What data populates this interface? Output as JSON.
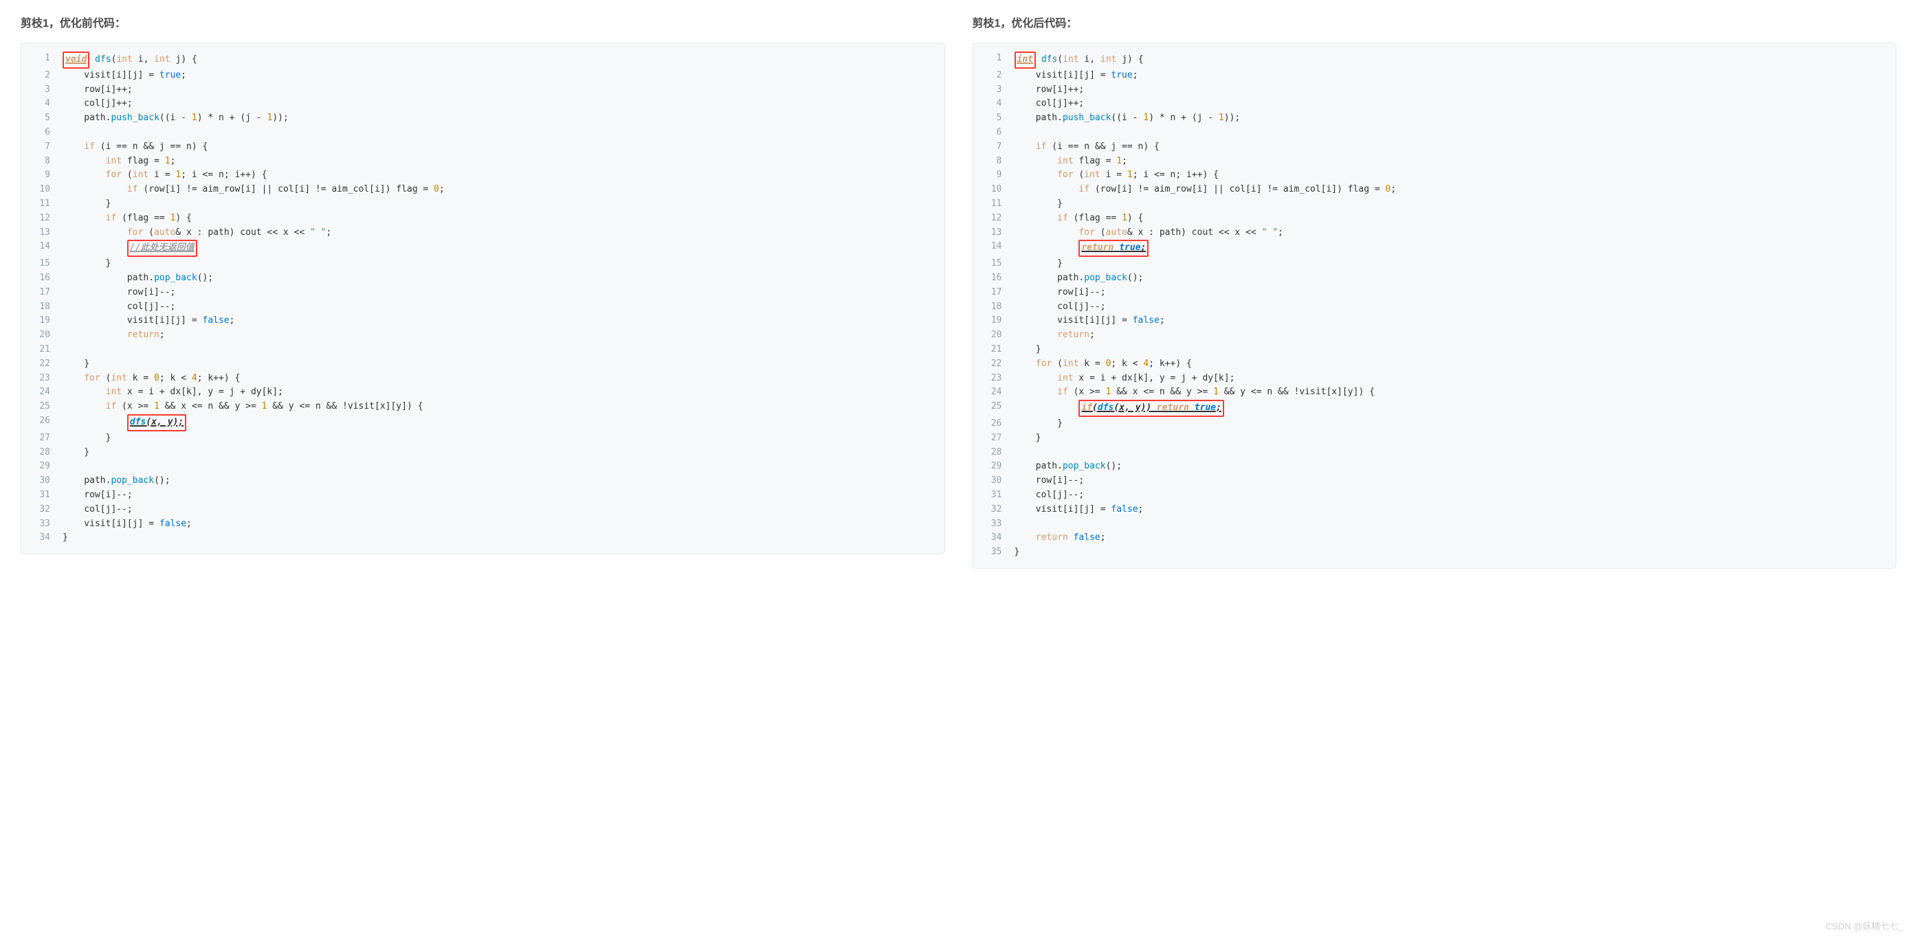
{
  "left": {
    "heading": "剪枝1，优化前代码：",
    "lines": [
      {
        "n": 1,
        "html": "<span class='redbox'><span class='em-under kw'>void</span></span> <span class='fn'>dfs</span>(<span class='kw'>int</span> i, <span class='kw'>int</span> j) {"
      },
      {
        "n": 2,
        "html": "    visit[i][j] = <span class='bool'>true</span>;"
      },
      {
        "n": 3,
        "html": "    row[i]++;"
      },
      {
        "n": 4,
        "html": "    col[j]++;"
      },
      {
        "n": 5,
        "html": "    path.<span class='fn'>push_back</span>((i - <span class='num'>1</span>) * n + (j - <span class='num'>1</span>));"
      },
      {
        "n": 6,
        "html": ""
      },
      {
        "n": 7,
        "html": "    <span class='kw'>if</span> (i == n &amp;&amp; j == n) {"
      },
      {
        "n": 8,
        "html": "        <span class='kw'>int</span> flag = <span class='num'>1</span>;"
      },
      {
        "n": 9,
        "html": "        <span class='kw'>for</span> (<span class='kw'>int</span> i = <span class='num'>1</span>; i &lt;= n; i++) {"
      },
      {
        "n": 10,
        "html": "            <span class='kw'>if</span> (row[i] != aim_row[i] || col[i] != aim_col[i]) flag = <span class='num'>0</span>;"
      },
      {
        "n": 11,
        "html": "        }"
      },
      {
        "n": 12,
        "html": "        <span class='kw'>if</span> (flag == <span class='num'>1</span>) {"
      },
      {
        "n": 13,
        "html": "            <span class='kw'>for</span> (<span class='kw'>auto</span>&amp; x : path) cout &lt;&lt; x &lt;&lt; <span class='str'>\" \"</span>;"
      },
      {
        "n": 14,
        "html": "            <span class='redbox'><span class='em-under comment'>//此处无返回值</span></span>"
      },
      {
        "n": 15,
        "html": "        }"
      },
      {
        "n": 16,
        "html": "            path.<span class='fn'>pop_back</span>();"
      },
      {
        "n": 17,
        "html": "            row[i]--;"
      },
      {
        "n": 18,
        "html": "            col[j]--;"
      },
      {
        "n": 19,
        "html": "            visit[i][j] = <span class='bool'>false</span>;"
      },
      {
        "n": 20,
        "html": "            <span class='kw'>return</span>;"
      },
      {
        "n": 21,
        "html": ""
      },
      {
        "n": 22,
        "html": "    }"
      },
      {
        "n": 23,
        "html": "    <span class='kw'>for</span> (<span class='kw'>int</span> k = <span class='num'>0</span>; k &lt; <span class='num'>4</span>; k++) {"
      },
      {
        "n": 24,
        "html": "        <span class='kw'>int</span> x = i + dx[k], y = j + dy[k];"
      },
      {
        "n": 25,
        "html": "        <span class='kw'>if</span> (x &gt;= <span class='num'>1</span> &amp;&amp; x &lt;= n &amp;&amp; y &gt;= <span class='num'>1</span> &amp;&amp; y &lt;= n &amp;&amp; !visit[x][y]) {"
      },
      {
        "n": 26,
        "html": "            <span class='redbox'><span class='em-under'><span class='fn'>dfs</span>(x, y);</span></span>"
      },
      {
        "n": 27,
        "html": "        }"
      },
      {
        "n": 28,
        "html": "    }"
      },
      {
        "n": 29,
        "html": ""
      },
      {
        "n": 30,
        "html": "    path.<span class='fn'>pop_back</span>();"
      },
      {
        "n": 31,
        "html": "    row[i]--;"
      },
      {
        "n": 32,
        "html": "    col[j]--;"
      },
      {
        "n": 33,
        "html": "    visit[i][j] = <span class='bool'>false</span>;"
      },
      {
        "n": 34,
        "html": "}"
      }
    ]
  },
  "right": {
    "heading": "剪枝1，优化后代码：",
    "lines": [
      {
        "n": 1,
        "html": "<span class='redbox'><span class='em-under kw'>int</span></span> <span class='fn'>dfs</span>(<span class='kw'>int</span> i, <span class='kw'>int</span> j) {"
      },
      {
        "n": 2,
        "html": "    visit[i][j] = <span class='bool'>true</span>;"
      },
      {
        "n": 3,
        "html": "    row[i]++;"
      },
      {
        "n": 4,
        "html": "    col[j]++;"
      },
      {
        "n": 5,
        "html": "    path.<span class='fn'>push_back</span>((i - <span class='num'>1</span>) * n + (j - <span class='num'>1</span>));"
      },
      {
        "n": 6,
        "html": ""
      },
      {
        "n": 7,
        "html": "    <span class='kw'>if</span> (i == n &amp;&amp; j == n) {"
      },
      {
        "n": 8,
        "html": "        <span class='kw'>int</span> flag = <span class='num'>1</span>;"
      },
      {
        "n": 9,
        "html": "        <span class='kw'>for</span> (<span class='kw'>int</span> i = <span class='num'>1</span>; i &lt;= n; i++) {"
      },
      {
        "n": 10,
        "html": "            <span class='kw'>if</span> (row[i] != aim_row[i] || col[i] != aim_col[i]) flag = <span class='num'>0</span>;"
      },
      {
        "n": 11,
        "html": "        }"
      },
      {
        "n": 12,
        "html": "        <span class='kw'>if</span> (flag == <span class='num'>1</span>) {"
      },
      {
        "n": 13,
        "html": "            <span class='kw'>for</span> (<span class='kw'>auto</span>&amp; x : path) cout &lt;&lt; x &lt;&lt; <span class='str'>\" \"</span>;"
      },
      {
        "n": 14,
        "html": "            <span class='redbox'><span class='em-under'><span class='kw'>return</span> <span class='bool'>true</span>;</span></span>"
      },
      {
        "n": 15,
        "html": "        }"
      },
      {
        "n": 16,
        "html": "        path.<span class='fn'>pop_back</span>();"
      },
      {
        "n": 17,
        "html": "        row[i]--;"
      },
      {
        "n": 18,
        "html": "        col[j]--;"
      },
      {
        "n": 19,
        "html": "        visit[i][j] = <span class='bool'>false</span>;"
      },
      {
        "n": 20,
        "html": "        <span class='kw'>return</span>;"
      },
      {
        "n": 21,
        "html": "    }"
      },
      {
        "n": 22,
        "html": "    <span class='kw'>for</span> (<span class='kw'>int</span> k = <span class='num'>0</span>; k &lt; <span class='num'>4</span>; k++) {"
      },
      {
        "n": 23,
        "html": "        <span class='kw'>int</span> x = i + dx[k], y = j + dy[k];"
      },
      {
        "n": 24,
        "html": "        <span class='kw'>if</span> (x &gt;= <span class='num'>1</span> &amp;&amp; x &lt;= n &amp;&amp; y &gt;= <span class='num'>1</span> &amp;&amp; y &lt;= n &amp;&amp; !visit[x][y]) {"
      },
      {
        "n": 25,
        "html": "            <span class='redbox'><span class='em-under'><span class='kw'>if</span>(<span class='fn'>dfs</span>(x, y)) <span class='kw'>return</span> <span class='bool'>true</span>;</span></span>"
      },
      {
        "n": 26,
        "html": "        }"
      },
      {
        "n": 27,
        "html": "    }"
      },
      {
        "n": 28,
        "html": ""
      },
      {
        "n": 29,
        "html": "    path.<span class='fn'>pop_back</span>();"
      },
      {
        "n": 30,
        "html": "    row[i]--;"
      },
      {
        "n": 31,
        "html": "    col[j]--;"
      },
      {
        "n": 32,
        "html": "    visit[i][j] = <span class='bool'>false</span>;"
      },
      {
        "n": 33,
        "html": ""
      },
      {
        "n": 34,
        "html": "    <span class='kw'>return</span> <span class='bool'>false</span>;"
      },
      {
        "n": 35,
        "html": "}"
      }
    ]
  },
  "watermark": "CSDN @妖精七七_"
}
